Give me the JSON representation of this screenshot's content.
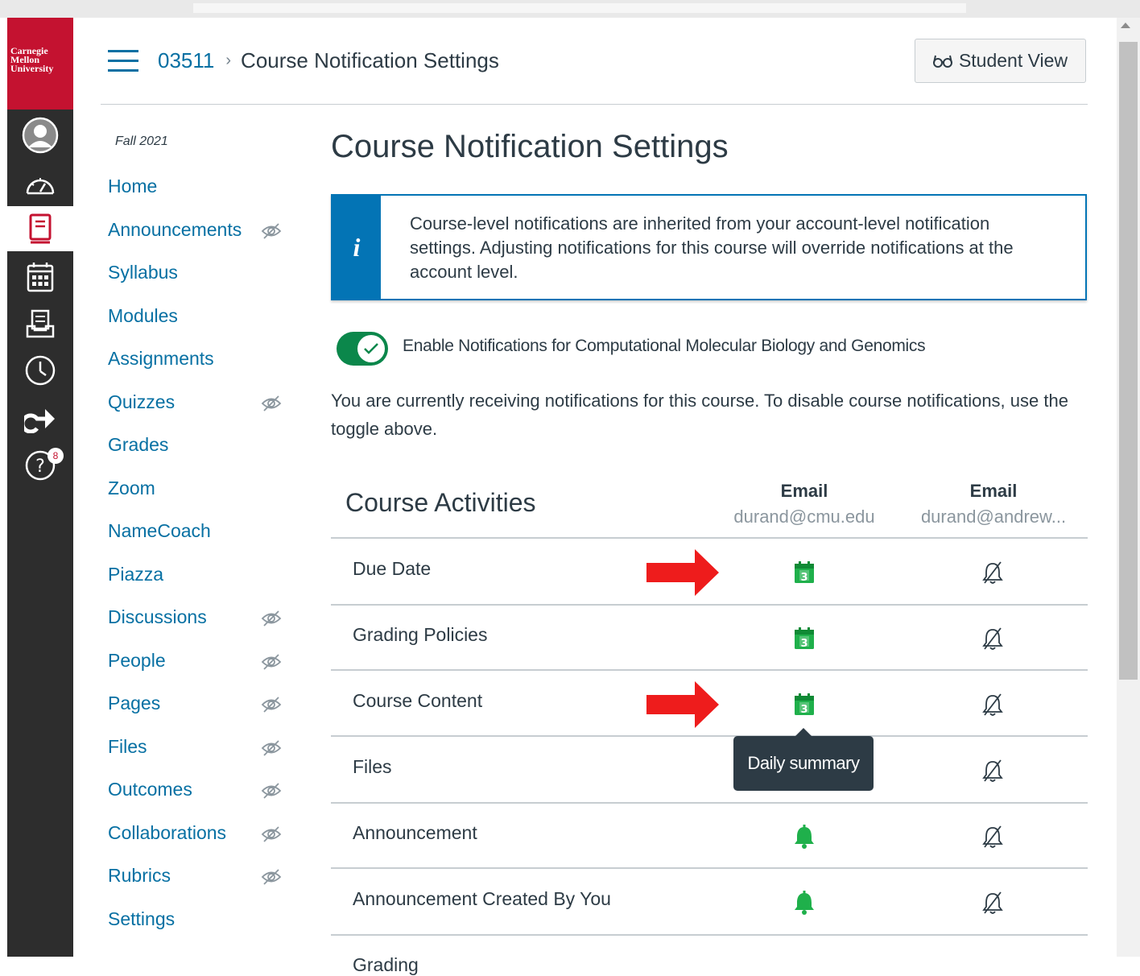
{
  "global_nav": {
    "logo": [
      "Carnegie",
      "Mellon",
      "University"
    ],
    "items": [
      {
        "name": "account",
        "icon": "user-avatar-icon"
      },
      {
        "name": "dashboard",
        "icon": "speedometer-icon"
      },
      {
        "name": "courses",
        "icon": "book-icon"
      },
      {
        "name": "calendar",
        "icon": "calendar-icon"
      },
      {
        "name": "inbox",
        "icon": "inbox-icon"
      },
      {
        "name": "history",
        "icon": "clock-icon"
      },
      {
        "name": "commons",
        "icon": "share-arrow-icon"
      },
      {
        "name": "help",
        "icon": "help-icon",
        "badge": "8"
      }
    ]
  },
  "header": {
    "course_code": "03511",
    "current_page": "Course Notification Settings",
    "student_view_label": "Student View"
  },
  "course_nav": {
    "term": "Fall 2021",
    "items": [
      {
        "label": "Home",
        "hidden": false
      },
      {
        "label": "Announcements",
        "hidden": true
      },
      {
        "label": "Syllabus",
        "hidden": false
      },
      {
        "label": "Modules",
        "hidden": false
      },
      {
        "label": "Assignments",
        "hidden": false
      },
      {
        "label": "Quizzes",
        "hidden": true
      },
      {
        "label": "Grades",
        "hidden": false
      },
      {
        "label": "Zoom",
        "hidden": false
      },
      {
        "label": "NameCoach",
        "hidden": false
      },
      {
        "label": "Piazza",
        "hidden": false
      },
      {
        "label": "Discussions",
        "hidden": true
      },
      {
        "label": "People",
        "hidden": true
      },
      {
        "label": "Pages",
        "hidden": true
      },
      {
        "label": "Files",
        "hidden": true
      },
      {
        "label": "Outcomes",
        "hidden": true
      },
      {
        "label": "Collaborations",
        "hidden": true
      },
      {
        "label": "Rubrics",
        "hidden": true
      },
      {
        "label": "Settings",
        "hidden": false
      }
    ]
  },
  "main": {
    "title": "Course Notification Settings",
    "info_icon": "i",
    "info_text": "Course-level notifications are inherited from your account-level notification settings. Adjusting notifications for this course will override notifications at the account level.",
    "toggle_label": "Enable Notifications for Computational Molecular Biology and Genomics",
    "toggle_on": true,
    "status_text": "You are currently receiving notifications for this course. To disable course notifications, use the toggle above.",
    "table": {
      "heading": "Course Activities",
      "columns": [
        {
          "type": "Email",
          "address": "durand@cmu.edu"
        },
        {
          "type": "Email",
          "address": "durand@andrew..."
        }
      ],
      "rows": [
        {
          "label": "Due Date",
          "email1": "daily-summary-calendar-icon",
          "email2": "bell-off-icon",
          "arrow": true
        },
        {
          "label": "Grading Policies",
          "email1": "daily-summary-calendar-icon",
          "email2": "bell-off-icon",
          "arrow": false
        },
        {
          "label": "Course Content",
          "email1": "daily-summary-calendar-icon",
          "email2": "bell-off-icon",
          "arrow": true
        },
        {
          "label": "Files",
          "email1": "daily-summary-calendar-icon",
          "email2": "bell-off-icon",
          "arrow": false
        },
        {
          "label": "Announcement",
          "email1": "bell-icon",
          "email2": "bell-off-icon",
          "arrow": false
        },
        {
          "label": "Announcement Created By You",
          "email1": "bell-icon",
          "email2": "bell-off-icon",
          "arrow": false
        },
        {
          "label": "Grading",
          "email1": "",
          "email2": "",
          "arrow": false
        }
      ],
      "calendar_digit": "3"
    },
    "tooltip": "Daily summary"
  },
  "colors": {
    "brand_red": "#c41230",
    "nav_dark": "#2d2d2d",
    "link_blue": "#0770a3",
    "info_blue": "#0374b5",
    "green": "#0b874b",
    "icon_green": "#1fb04b",
    "arrow_red": "#ee1c1c"
  }
}
